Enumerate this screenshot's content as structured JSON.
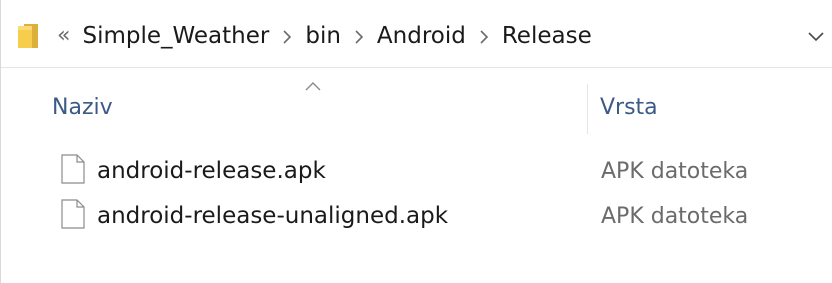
{
  "breadcrumb": {
    "overflow": "«",
    "items": [
      {
        "label": "Simple_Weather"
      },
      {
        "label": "bin"
      },
      {
        "label": "Android"
      },
      {
        "label": "Release"
      }
    ]
  },
  "columns": {
    "name": "Naziv",
    "type": "Vrsta",
    "sorted_by": "name",
    "sort_direction": "ascending"
  },
  "files": [
    {
      "name": "android-release.apk",
      "type": "APK datoteka",
      "icon": "file-icon"
    },
    {
      "name": "android-release-unaligned.apk",
      "type": "APK datoteka",
      "icon": "file-icon"
    }
  ],
  "colors": {
    "folder": "#f0c540",
    "header_text": "#3c5a86",
    "type_text": "#6b6b6b"
  }
}
